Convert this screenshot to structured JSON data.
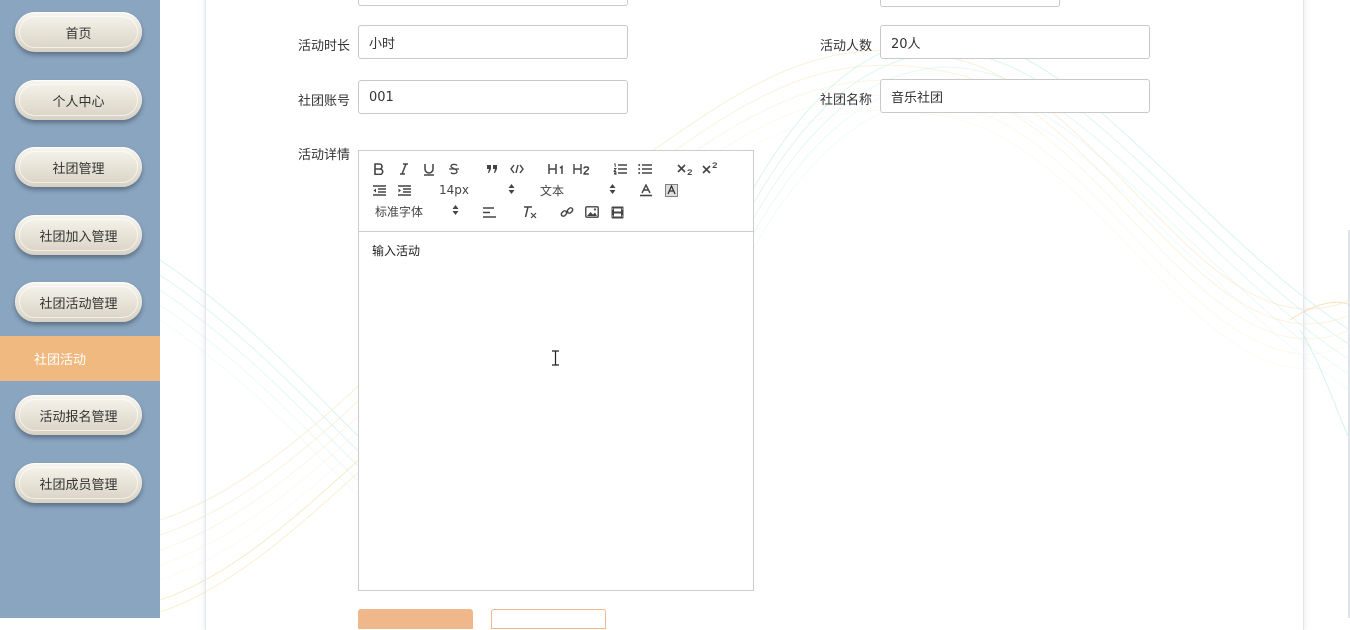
{
  "sidebar": {
    "items": [
      {
        "label": "首页"
      },
      {
        "label": "个人中心"
      },
      {
        "label": "社团管理"
      },
      {
        "label": "社团加入管理"
      },
      {
        "label": "社团活动管理"
      },
      {
        "label": "社团活动"
      },
      {
        "label": "活动报名管理"
      },
      {
        "label": "社团成员管理"
      }
    ],
    "active_index": 5
  },
  "form": {
    "duration": {
      "label": "活动时长",
      "value": "小时"
    },
    "people": {
      "label": "活动人数",
      "value": "20人"
    },
    "club_account": {
      "label": "社团账号",
      "value": "001"
    },
    "club_name": {
      "label": "社团名称",
      "value": "音乐社团"
    },
    "details": {
      "label": "活动详情"
    }
  },
  "editor": {
    "font_size": "14px",
    "header_select": "文本",
    "font_family": "标准字体",
    "content": "输入活动",
    "toolbar_icons": [
      "bold-icon",
      "italic-icon",
      "underline-icon",
      "strike-icon",
      "blockquote-icon",
      "code-icon",
      "h1-icon",
      "h2-icon",
      "ordered-list-icon",
      "bullet-list-icon",
      "subscript-icon",
      "superscript-icon",
      "outdent-icon",
      "indent-icon",
      "font-color-icon",
      "background-color-icon",
      "align-icon",
      "clean-format-icon",
      "link-icon",
      "image-icon",
      "video-icon"
    ]
  },
  "colors": {
    "sidebar_bg": "#8aa5bf",
    "active_bg": "#f0b97f",
    "accent": "#f0b78a"
  }
}
